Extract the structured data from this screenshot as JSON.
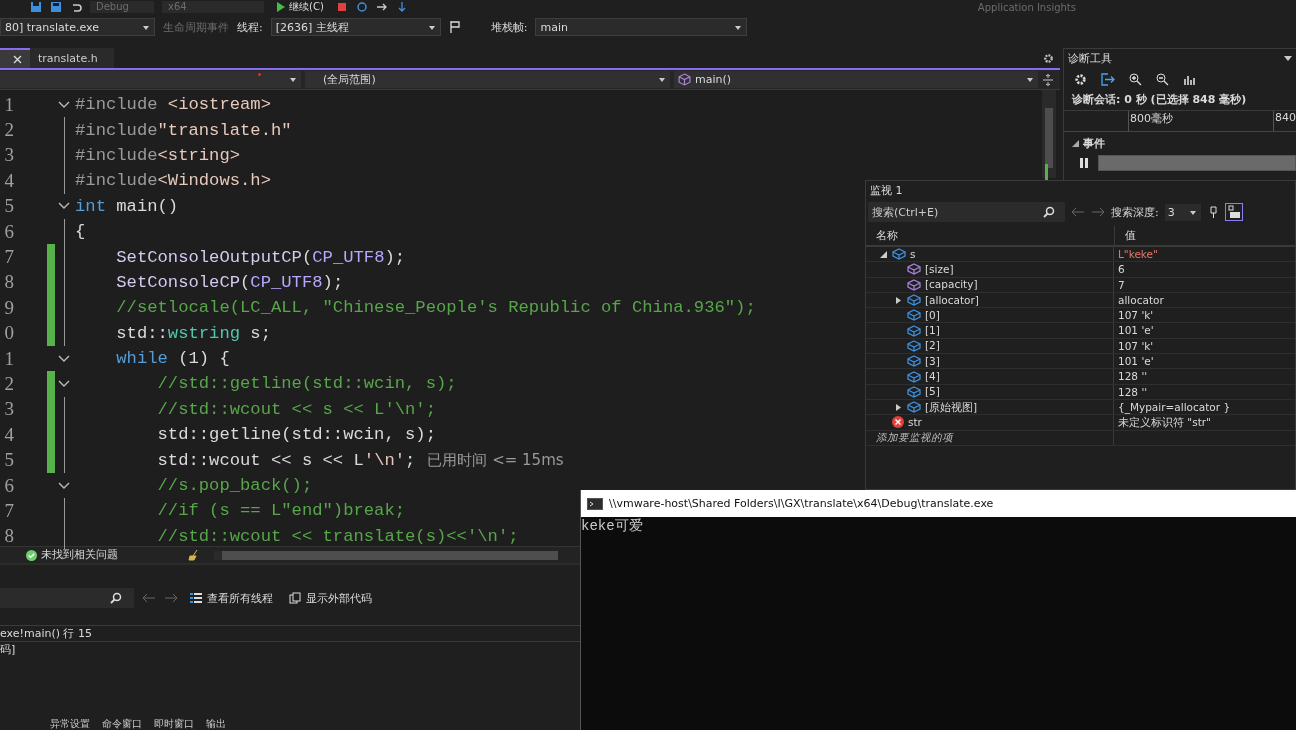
{
  "toolbar_top": {
    "configuration": "Debug",
    "platform": "x64",
    "continue_button": "继续(C)",
    "insights": "Application Insights"
  },
  "debug_location": {
    "process": "80] translate.exe",
    "lifecycle_events": "生命周期事件",
    "thread_label": "线程:",
    "thread": "[2636] 主线程",
    "stack_frame_label": "堆栈帧:",
    "stack_frame": "main"
  },
  "tabs": [
    {
      "selected": true
    },
    {
      "label": "translate.h",
      "selected": false
    }
  ],
  "nav_bar": {
    "scope": "(全局范围)",
    "member": "main()"
  },
  "editor": {
    "lines": [
      {
        "number": "1",
        "collapsible": true,
        "changed": false,
        "tokens": [
          {
            "t": "#include",
            "kind": "pre"
          },
          {
            "t": " <iostream>",
            "kind": "header"
          }
        ]
      },
      {
        "number": "2",
        "collapsible": false,
        "changed": false,
        "tokens": [
          {
            "t": "#include",
            "kind": "pre"
          },
          {
            "t": "\"translate.h\"",
            "kind": "string"
          }
        ]
      },
      {
        "number": "3",
        "collapsible": false,
        "changed": false,
        "tokens": [
          {
            "t": "#include",
            "kind": "pre"
          },
          {
            "t": "<string>",
            "kind": "header"
          }
        ]
      },
      {
        "number": "4",
        "collapsible": false,
        "changed": false,
        "tokens": [
          {
            "t": "#include",
            "kind": "pre"
          },
          {
            "t": "<Windows.h>",
            "kind": "header"
          }
        ]
      },
      {
        "number": "5",
        "collapsible": true,
        "changed": false,
        "tokens": [
          {
            "t": "int",
            "kind": "keyword"
          },
          {
            "t": " main()",
            "kind": "plain"
          }
        ]
      },
      {
        "number": "6",
        "collapsible": false,
        "changed": false,
        "tokens": [
          {
            "t": "{",
            "kind": "plain"
          }
        ]
      },
      {
        "number": "7",
        "collapsible": false,
        "changed": true,
        "tokens": [
          {
            "t": "    SetConsoleOutputCP",
            "kind": "function"
          },
          {
            "t": "(",
            "kind": "plain"
          },
          {
            "t": "CP_UTF8",
            "kind": "macro"
          },
          {
            "t": ");",
            "kind": "plain"
          }
        ]
      },
      {
        "number": "8",
        "collapsible": false,
        "changed": true,
        "tokens": [
          {
            "t": "    SetConsoleCP",
            "kind": "function"
          },
          {
            "t": "(",
            "kind": "plain"
          },
          {
            "t": "CP_UTF8",
            "kind": "macro"
          },
          {
            "t": ");",
            "kind": "plain"
          }
        ]
      },
      {
        "number": "9",
        "collapsible": false,
        "changed": true,
        "tokens": [
          {
            "t": "    //setlocale(LC_ALL, \"Chinese_People's Republic of China.936\");",
            "kind": "comment"
          }
        ]
      },
      {
        "number": "0",
        "collapsible": false,
        "changed": true,
        "tokens": [
          {
            "t": "    std::",
            "kind": "plain"
          },
          {
            "t": "wstring",
            "kind": "type"
          },
          {
            "t": " s;",
            "kind": "plain"
          }
        ]
      },
      {
        "number": "1",
        "collapsible": true,
        "changed": false,
        "tokens": [
          {
            "t": "    while",
            "kind": "keyword"
          },
          {
            "t": " (1) {",
            "kind": "plain"
          }
        ]
      },
      {
        "number": "2",
        "collapsible": true,
        "changed": true,
        "tokens": [
          {
            "t": "        //std::getline(std::wcin, s);",
            "kind": "comment"
          }
        ]
      },
      {
        "number": "3",
        "collapsible": false,
        "changed": true,
        "tokens": [
          {
            "t": "        //std::wcout << s << L'\\n';",
            "kind": "comment"
          }
        ]
      },
      {
        "number": "4",
        "collapsible": false,
        "changed": true,
        "tokens": [
          {
            "t": "        std::getline(std::wcin, s);",
            "kind": "plain"
          }
        ]
      },
      {
        "number": "5",
        "collapsible": false,
        "changed": true,
        "tokens": [
          {
            "t": "        std::wcout << s << L",
            "kind": "plain"
          },
          {
            "t": "'\\n'",
            "kind": "string"
          },
          {
            "t": ";",
            "kind": "plain"
          }
        ],
        "hint": "已用时间 <= 15ms"
      },
      {
        "number": "6",
        "collapsible": true,
        "changed": false,
        "tokens": [
          {
            "t": "        //s.pop_back();",
            "kind": "comment"
          }
        ]
      },
      {
        "number": "7",
        "collapsible": false,
        "changed": false,
        "tokens": [
          {
            "t": "        //if (s == L\"end\")break;",
            "kind": "comment"
          }
        ]
      },
      {
        "number": "8",
        "collapsible": false,
        "changed": false,
        "tokens": [
          {
            "t": "        //std::wcout << translate(s)<<'\\n';",
            "kind": "comment"
          }
        ]
      }
    ]
  },
  "editor_status": {
    "issues": "未找到相关问题"
  },
  "call_stack": {
    "view_threads": "查看所有线程",
    "external_code": "显示外部代码",
    "rows": [
      "exe!main() 行 15",
      "码]"
    ]
  },
  "bottom_tabs": [
    "异常设置",
    "命令窗口",
    "即时窗口",
    "输出"
  ],
  "diagnostics": {
    "title": "诊断工具",
    "session": "诊断会话: 0 秒 (已选择 848 毫秒)",
    "ruler": [
      "800毫秒",
      "840"
    ],
    "events_label": "事件"
  },
  "watch": {
    "title": "监视 1",
    "search_placeholder": "搜索(Ctrl+E)",
    "depth_label": "搜索深度:",
    "depth": "3",
    "columns": [
      "名称",
      "值"
    ],
    "rows": [
      {
        "name": "s",
        "value": "L\"keke\"",
        "kind": "object",
        "changed": true,
        "expanded": true,
        "children": [
          {
            "name": "[size]",
            "value": "6",
            "kind": "property",
            "changed": false
          },
          {
            "name": "[capacity]",
            "value": "7",
            "kind": "property",
            "changed": false
          },
          {
            "name": "[allocator]",
            "value": "allocator",
            "kind": "object",
            "changed": false,
            "expanded": false
          },
          {
            "name": "[0]",
            "value": "107 'k'",
            "kind": "object",
            "changed": false
          },
          {
            "name": "[1]",
            "value": "101 'e'",
            "kind": "object",
            "changed": false
          },
          {
            "name": "[2]",
            "value": "107 'k'",
            "kind": "object",
            "changed": false
          },
          {
            "name": "[3]",
            "value": "101 'e'",
            "kind": "object",
            "changed": false
          },
          {
            "name": "[4]",
            "value": "128 ''",
            "kind": "object",
            "changed": false
          },
          {
            "name": "[5]",
            "value": "128 ''",
            "kind": "object",
            "changed": false
          },
          {
            "name": "[原始视图]",
            "value": "{_Mypair=allocator }",
            "kind": "object",
            "changed": false,
            "expanded": false
          }
        ]
      },
      {
        "name": "str",
        "value": "未定义标识符 \"str\"",
        "kind": "error",
        "changed": false
      }
    ],
    "add_hint": "添加要监视的项"
  },
  "console": {
    "title": "\\\\vmware-host\\Shared Folders\\I\\GX\\translate\\x64\\Debug\\translate.exe",
    "output": "keke可爱"
  }
}
